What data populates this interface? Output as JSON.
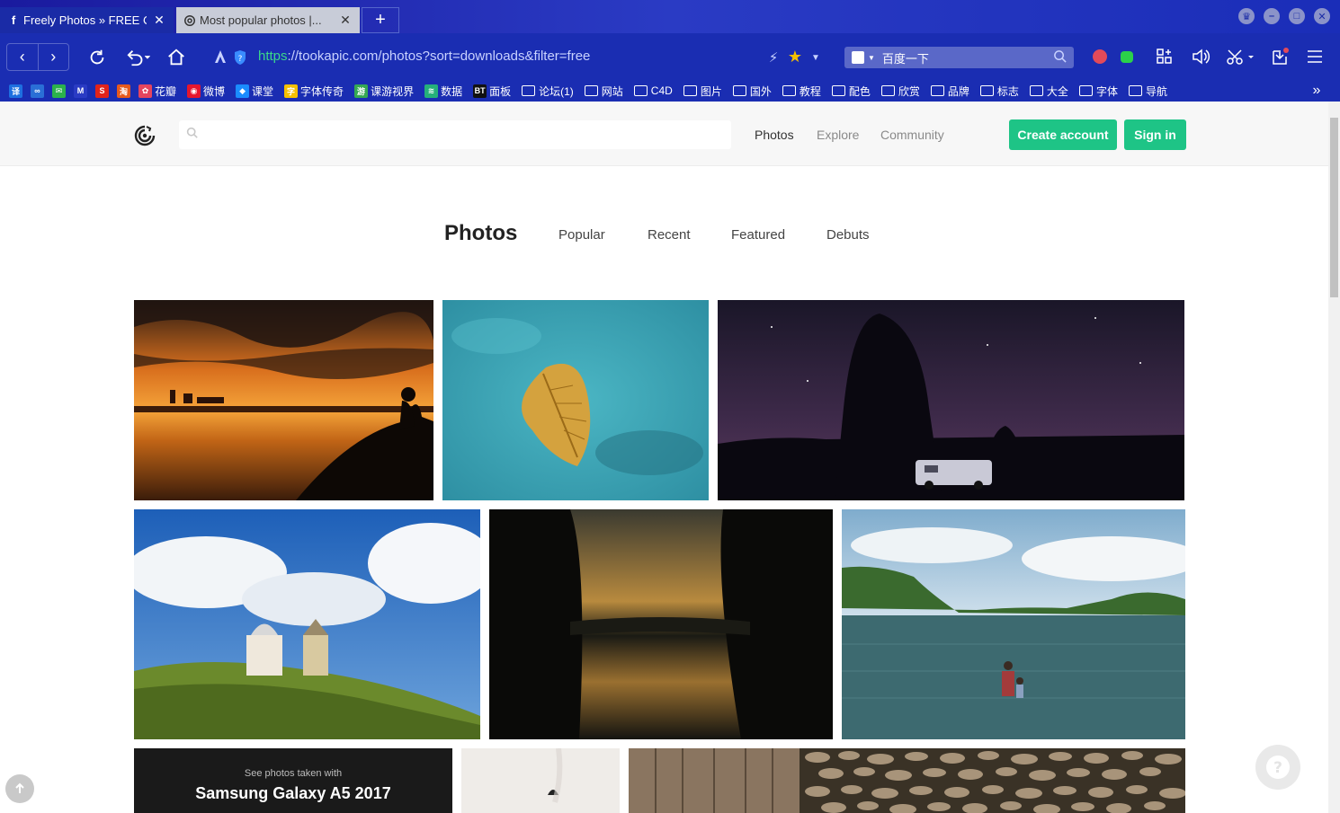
{
  "browser": {
    "tabs": [
      {
        "title": "Freely Photos » FREE C...",
        "favicon": "f",
        "close": "✕"
      },
      {
        "title": "Most popular photos |...",
        "favicon": "tookapic-icon",
        "close": "✕"
      }
    ],
    "new_tab": "+",
    "url_scheme": "https",
    "url_rest": "://tookapic.com/photos?sort=downloads&filter=free",
    "search_engine_text": "百度一下",
    "bookmarks": [
      {
        "label": "",
        "icon": "译",
        "color": "#1e6fe0"
      },
      {
        "label": "",
        "icon": "∞",
        "color": "#2a6fd6"
      },
      {
        "label": "",
        "icon": "✉",
        "color": "#2bb24c"
      },
      {
        "label": "",
        "icon": "M",
        "color": "#2a3bc4"
      },
      {
        "label": "",
        "icon": "S",
        "color": "#e2231a"
      },
      {
        "label": "",
        "icon": "淘",
        "color": "#e75a1d"
      },
      {
        "label": "花瓣",
        "icon": "✿",
        "color": "#e5455e"
      },
      {
        "label": "微博",
        "icon": "◉",
        "color": "#e6162d"
      },
      {
        "label": "课堂",
        "icon": "◆",
        "color": "#1a8cff"
      },
      {
        "label": "字体传奇",
        "icon": "字",
        "color": "#f5c000"
      },
      {
        "label": "课游视界",
        "icon": "游",
        "color": "#35a853"
      },
      {
        "label": "数据",
        "icon": "≋",
        "color": "#25b07a"
      },
      {
        "label": "面板",
        "icon": "BT",
        "color": "#111111"
      }
    ],
    "folders": [
      "论坛(1)",
      "网站",
      "C4D",
      "图片",
      "国外",
      "教程",
      "配色",
      "欣赏",
      "品牌",
      "标志",
      "大全",
      "字体",
      "导航"
    ]
  },
  "site": {
    "search_placeholder": "",
    "nav": [
      "Photos",
      "Explore",
      "Community"
    ],
    "create_account": "Create account",
    "sign_in": "Sign in"
  },
  "subnav": {
    "title": "Photos",
    "items": [
      "Popular",
      "Recent",
      "Featured",
      "Debuts"
    ]
  },
  "promo": {
    "caption": "See photos taken with",
    "device": "Samsung Galaxy A5 2017"
  },
  "photos": [
    "sunset-silhouette",
    "autumn-leaf-water",
    "starry-night-van",
    "hilltop-chapel",
    "lake-reflection",
    "father-son-lake",
    "snow-texture",
    "wood-stones"
  ]
}
